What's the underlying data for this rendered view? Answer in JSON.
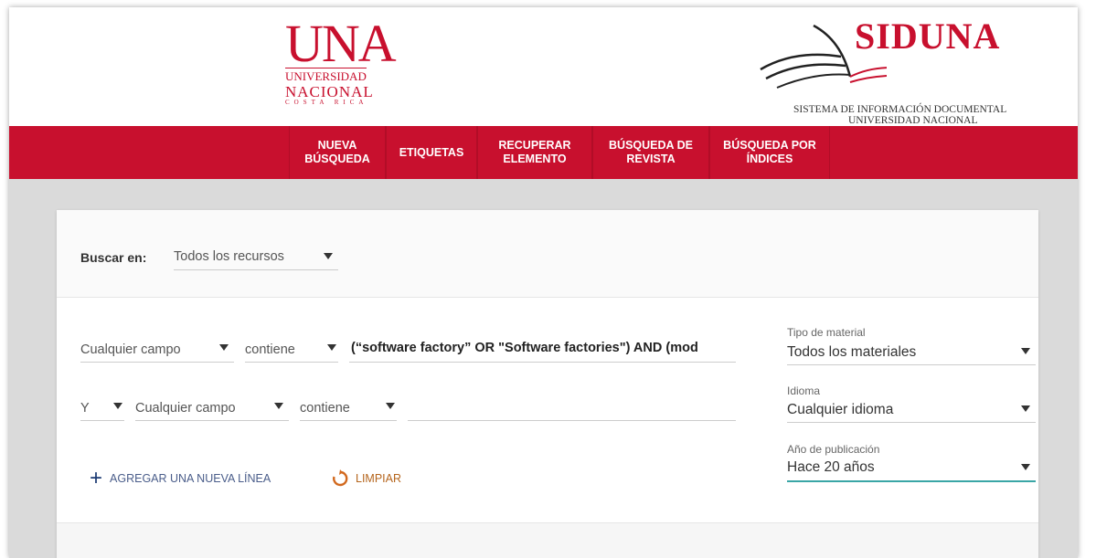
{
  "header": {
    "una_logo": {
      "big": "UNA",
      "line1": "UNIVERSIDAD",
      "line2": "NACIONAL",
      "line3": "COSTA RICA"
    },
    "siduna": {
      "title": "SIDUNA",
      "subtitle_line1": "SISTEMA DE INFORMACIÓN DOCUMENTAL",
      "subtitle_line2": "UNIVERSIDAD NACIONAL"
    }
  },
  "nav": {
    "items": [
      {
        "label": "NUEVA\nBÚSQUEDA"
      },
      {
        "label": "ETIQUETAS"
      },
      {
        "label": "RECUPERAR\nELEMENTO"
      },
      {
        "label": "BÚSQUEDA DE\nREVISTA"
      },
      {
        "label": "BÚSQUEDA POR\nÍNDICES"
      }
    ]
  },
  "search": {
    "scope_label": "Buscar en:",
    "scope_value": "Todos los recursos",
    "row1": {
      "field": "Cualquier campo",
      "operator": "contiene",
      "query": "(“software factory” OR \"Software factories\") AND (mod"
    },
    "row2": {
      "boolean": "Y",
      "field": "Cualquier campo",
      "operator": "contiene",
      "query": ""
    },
    "add_line": "AGREGAR UNA NUEVA LÍNEA",
    "clear": "LIMPIAR"
  },
  "filters": {
    "material": {
      "label": "Tipo de material",
      "value": "Todos los materiales"
    },
    "language": {
      "label": "Idioma",
      "value": "Cualquier idioma"
    },
    "year": {
      "label": "Año de publicación",
      "value": "Hace 20 años"
    }
  },
  "colors": {
    "brand_red": "#c8102e",
    "accent_teal": "#3aa6a6",
    "clear_orange": "#d2691e"
  }
}
